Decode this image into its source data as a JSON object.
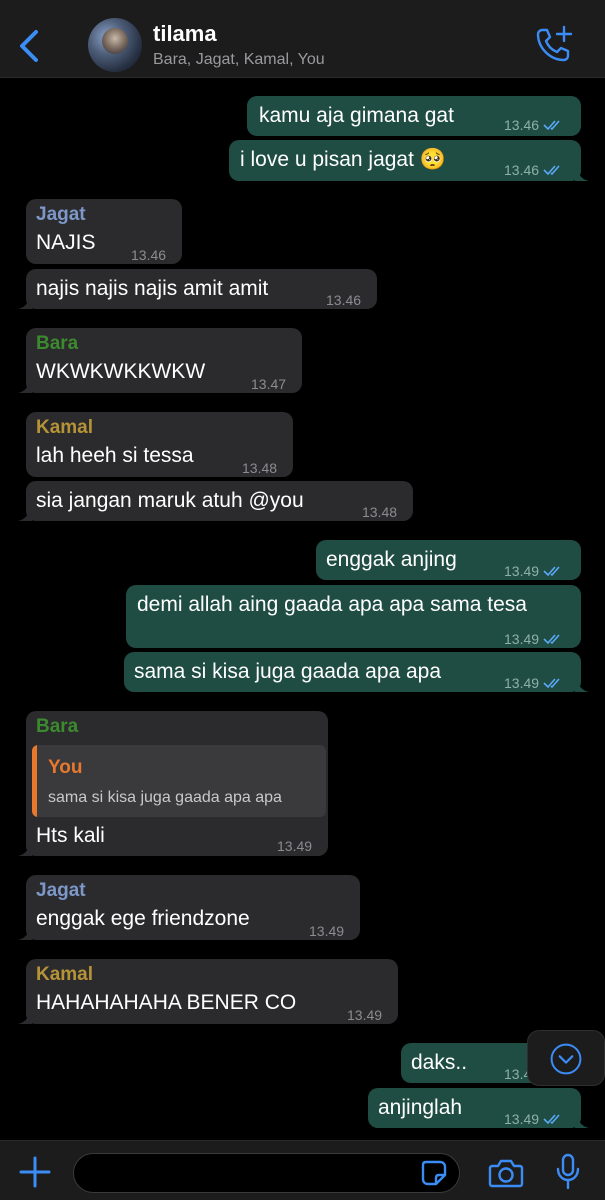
{
  "header": {
    "title": "tilama",
    "members": "Bara, Jagat, Kamal, You"
  },
  "messages": [
    {
      "dir": "out",
      "text": "kamu aja gimana gat",
      "time": "13.46"
    },
    {
      "dir": "out",
      "text": "i love u pisan jagat 🥺",
      "time": "13.46"
    },
    {
      "dir": "in",
      "sender": "Jagat",
      "text": "NAJIS",
      "time": "13.46"
    },
    {
      "dir": "in",
      "text": "najis najis najis amit amit",
      "time": "13.46"
    },
    {
      "dir": "in",
      "sender": "Bara",
      "text": "WKWKWKKWKW",
      "time": "13.47"
    },
    {
      "dir": "in",
      "sender": "Kamal",
      "text": "lah heeh si tessa",
      "time": "13.48"
    },
    {
      "dir": "in",
      "text": "sia jangan maruk atuh @you",
      "time": "13.48"
    },
    {
      "dir": "out",
      "text": "enggak anjing",
      "time": "13.49"
    },
    {
      "dir": "out",
      "text": "demi allah aing gaada apa apa sama tesa",
      "time": "13.49"
    },
    {
      "dir": "out",
      "text": "sama si kisa juga gaada apa apa",
      "time": "13.49"
    },
    {
      "dir": "in",
      "sender": "Bara",
      "reply_to": {
        "name": "You",
        "text": "sama si kisa juga gaada apa apa"
      },
      "text": "Hts kali",
      "time": "13.49"
    },
    {
      "dir": "in",
      "sender": "Jagat",
      "text": "enggak ege friendzone",
      "time": "13.49"
    },
    {
      "dir": "in",
      "sender": "Kamal",
      "text": "HAHAHAHAHA BENER CO",
      "time": "13.49"
    },
    {
      "dir": "out",
      "text": "daks..",
      "time": "13.49"
    },
    {
      "dir": "out",
      "text": "anjinglah",
      "time": "13.49"
    }
  ],
  "colors": {
    "incoming_bubble": "#2b2b2d",
    "outgoing_bubble": "#1f4d43",
    "accent": "#3b8cf5",
    "jagat": "#7c97c8",
    "bara": "#3c8a2f",
    "kamal": "#b59336",
    "you": "#e8782b"
  },
  "icons": {
    "back": "chevron-left-icon",
    "call": "add-call-icon",
    "scroll": "chevron-down-circle-icon",
    "attach": "plus-icon",
    "sticker": "sticker-icon",
    "camera": "camera-icon",
    "mic": "microphone-icon"
  }
}
